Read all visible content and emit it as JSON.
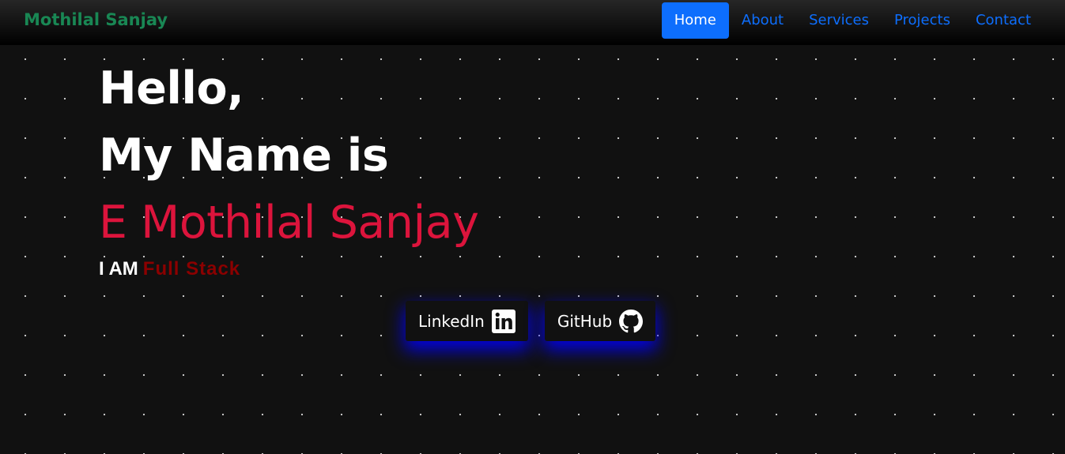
{
  "navbar": {
    "brand": "Mothilal Sanjay",
    "links": [
      {
        "label": "Home",
        "active": true
      },
      {
        "label": "About"
      },
      {
        "label": "Services"
      },
      {
        "label": "Projects"
      },
      {
        "label": "Contact"
      }
    ]
  },
  "hero": {
    "line1": "Hello,",
    "line2": "My Name is",
    "name": "E Mothilal Sanjay",
    "role_prefix": "I AM",
    "role": "Full Stack"
  },
  "social": {
    "linkedin_label": "LinkedIn",
    "linkedin_icon": "linkedin-icon",
    "github_label": "GitHub",
    "github_icon": "github-icon"
  },
  "colors": {
    "background": "#111111",
    "brand": "#198754",
    "nav_link": "#0d6efd",
    "name": "#dc143c",
    "role": "#8b0000",
    "button_glow": "#0000ff"
  }
}
